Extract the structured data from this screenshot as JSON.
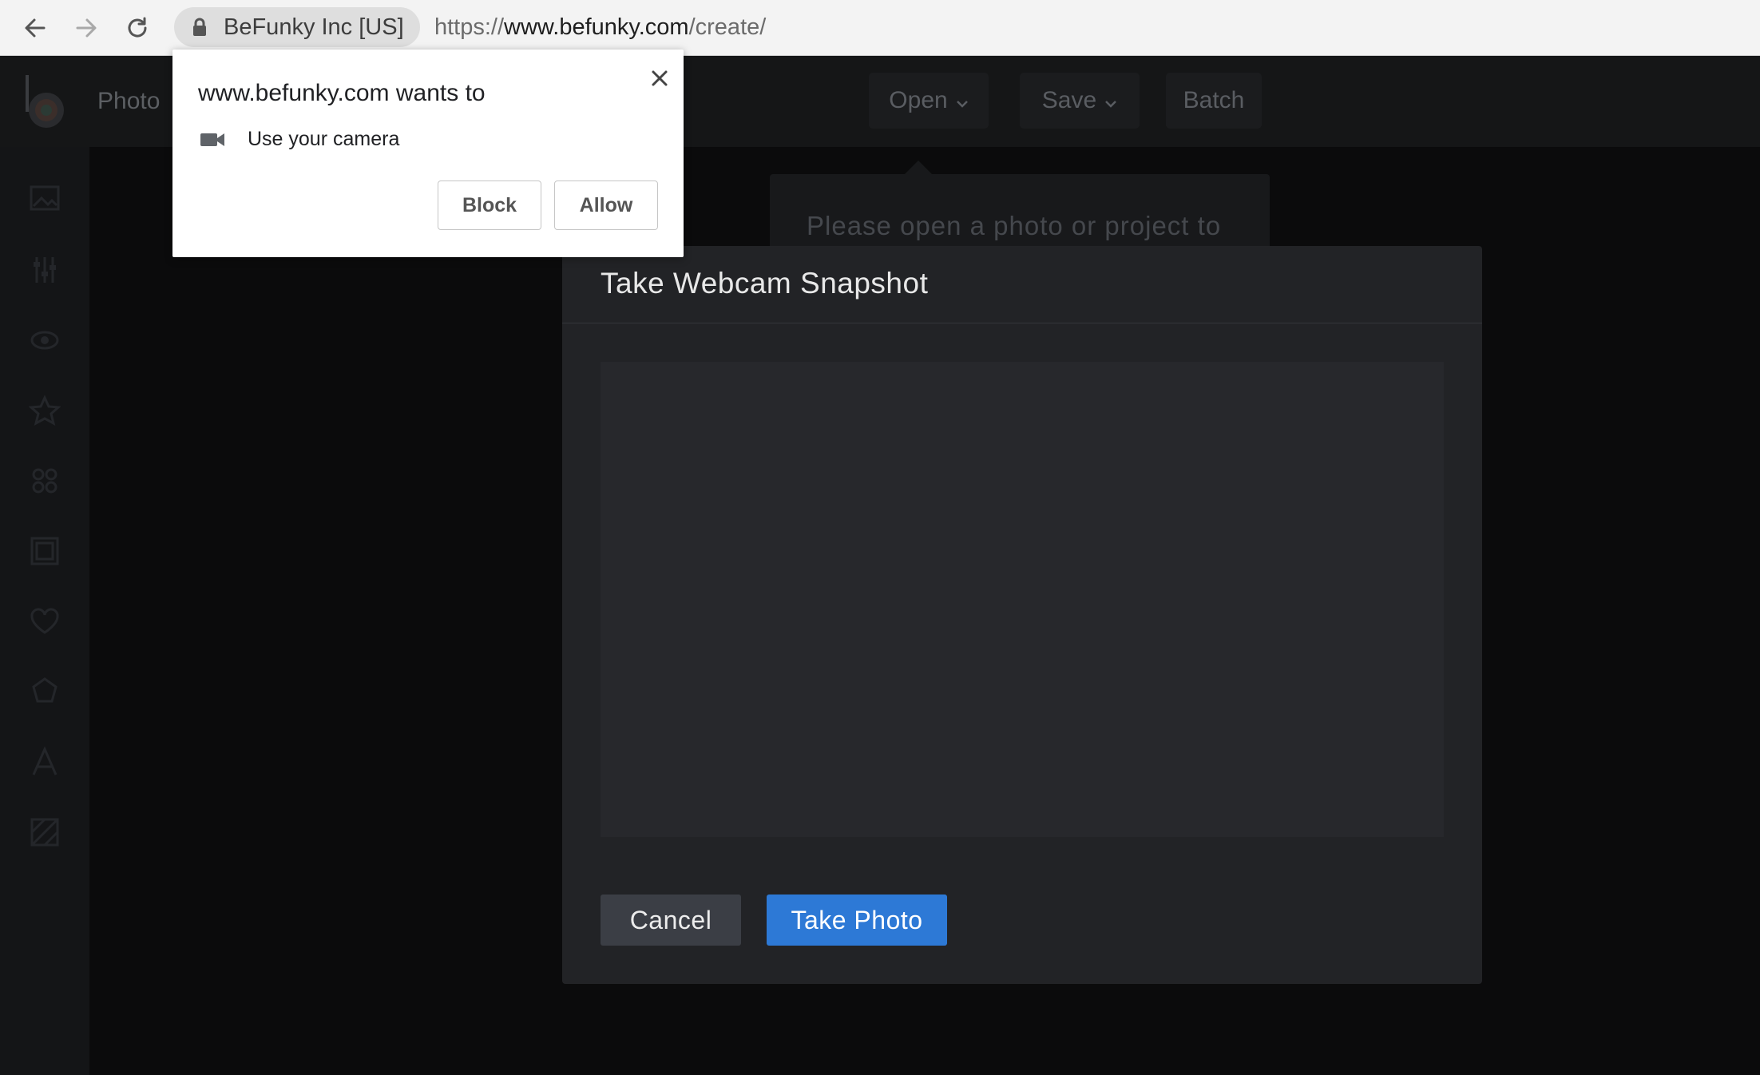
{
  "browser": {
    "site_identity": "BeFunky Inc [US]",
    "url_scheme": "https://",
    "url_host": "www.befunky.com",
    "url_path": "/create/",
    "icons": {
      "back": "arrow-left-icon",
      "forward": "arrow-right-icon",
      "reload": "reload-icon",
      "lock": "lock-icon"
    }
  },
  "app": {
    "title": "Photo",
    "menu": {
      "open": "Open",
      "save": "Save",
      "batch": "Batch"
    },
    "hint": "Please open a photo or project to",
    "sidebar_icons": [
      "image-icon",
      "adjust-icon",
      "eye-icon",
      "star-icon",
      "graphics-icon",
      "frame-icon",
      "heart-icon",
      "shape-icon",
      "text-icon",
      "texture-icon"
    ]
  },
  "modal": {
    "title": "Take Webcam Snapshot",
    "cancel_label": "Cancel",
    "take_photo_label": "Take Photo"
  },
  "permission": {
    "title": "www.befunky.com wants to",
    "request": "Use your camera",
    "block_label": "Block",
    "allow_label": "Allow"
  },
  "colors": {
    "accent": "#2d79d6",
    "modal_bg": "#222326",
    "page_bg": "#0b0b0c"
  }
}
